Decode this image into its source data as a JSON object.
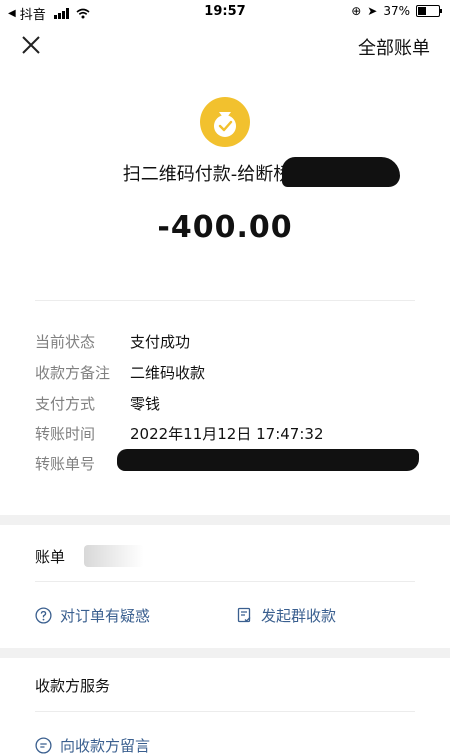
{
  "status_bar": {
    "app": "抖音",
    "time": "19:57",
    "battery": "37%"
  },
  "header": {
    "all_bills": "全部账单"
  },
  "transaction": {
    "title": "扫二维码付款-给断桥残雪",
    "amount": "-400.00"
  },
  "details": [
    {
      "label": "当前状态",
      "value": "支付成功"
    },
    {
      "label": "收款方备注",
      "value": "二维码收款"
    },
    {
      "label": "支付方式",
      "value": "零钱"
    },
    {
      "label": "转账时间",
      "value": "2022年11月12日 17:47:32"
    },
    {
      "label": "转账单号",
      "value": ""
    }
  ],
  "bill_service": {
    "title": "账单",
    "actions": [
      {
        "label": "对订单有疑惑",
        "icon": "question-circle-icon"
      },
      {
        "label": "发起群收款",
        "icon": "group-collect-icon"
      }
    ]
  },
  "payee_service": {
    "title": "收款方服务",
    "actions": [
      {
        "label": "向收款方留言",
        "icon": "message-icon"
      }
    ]
  },
  "colors": {
    "accent": "#f2c12e",
    "link": "#3a5f8f",
    "label": "#808080"
  }
}
